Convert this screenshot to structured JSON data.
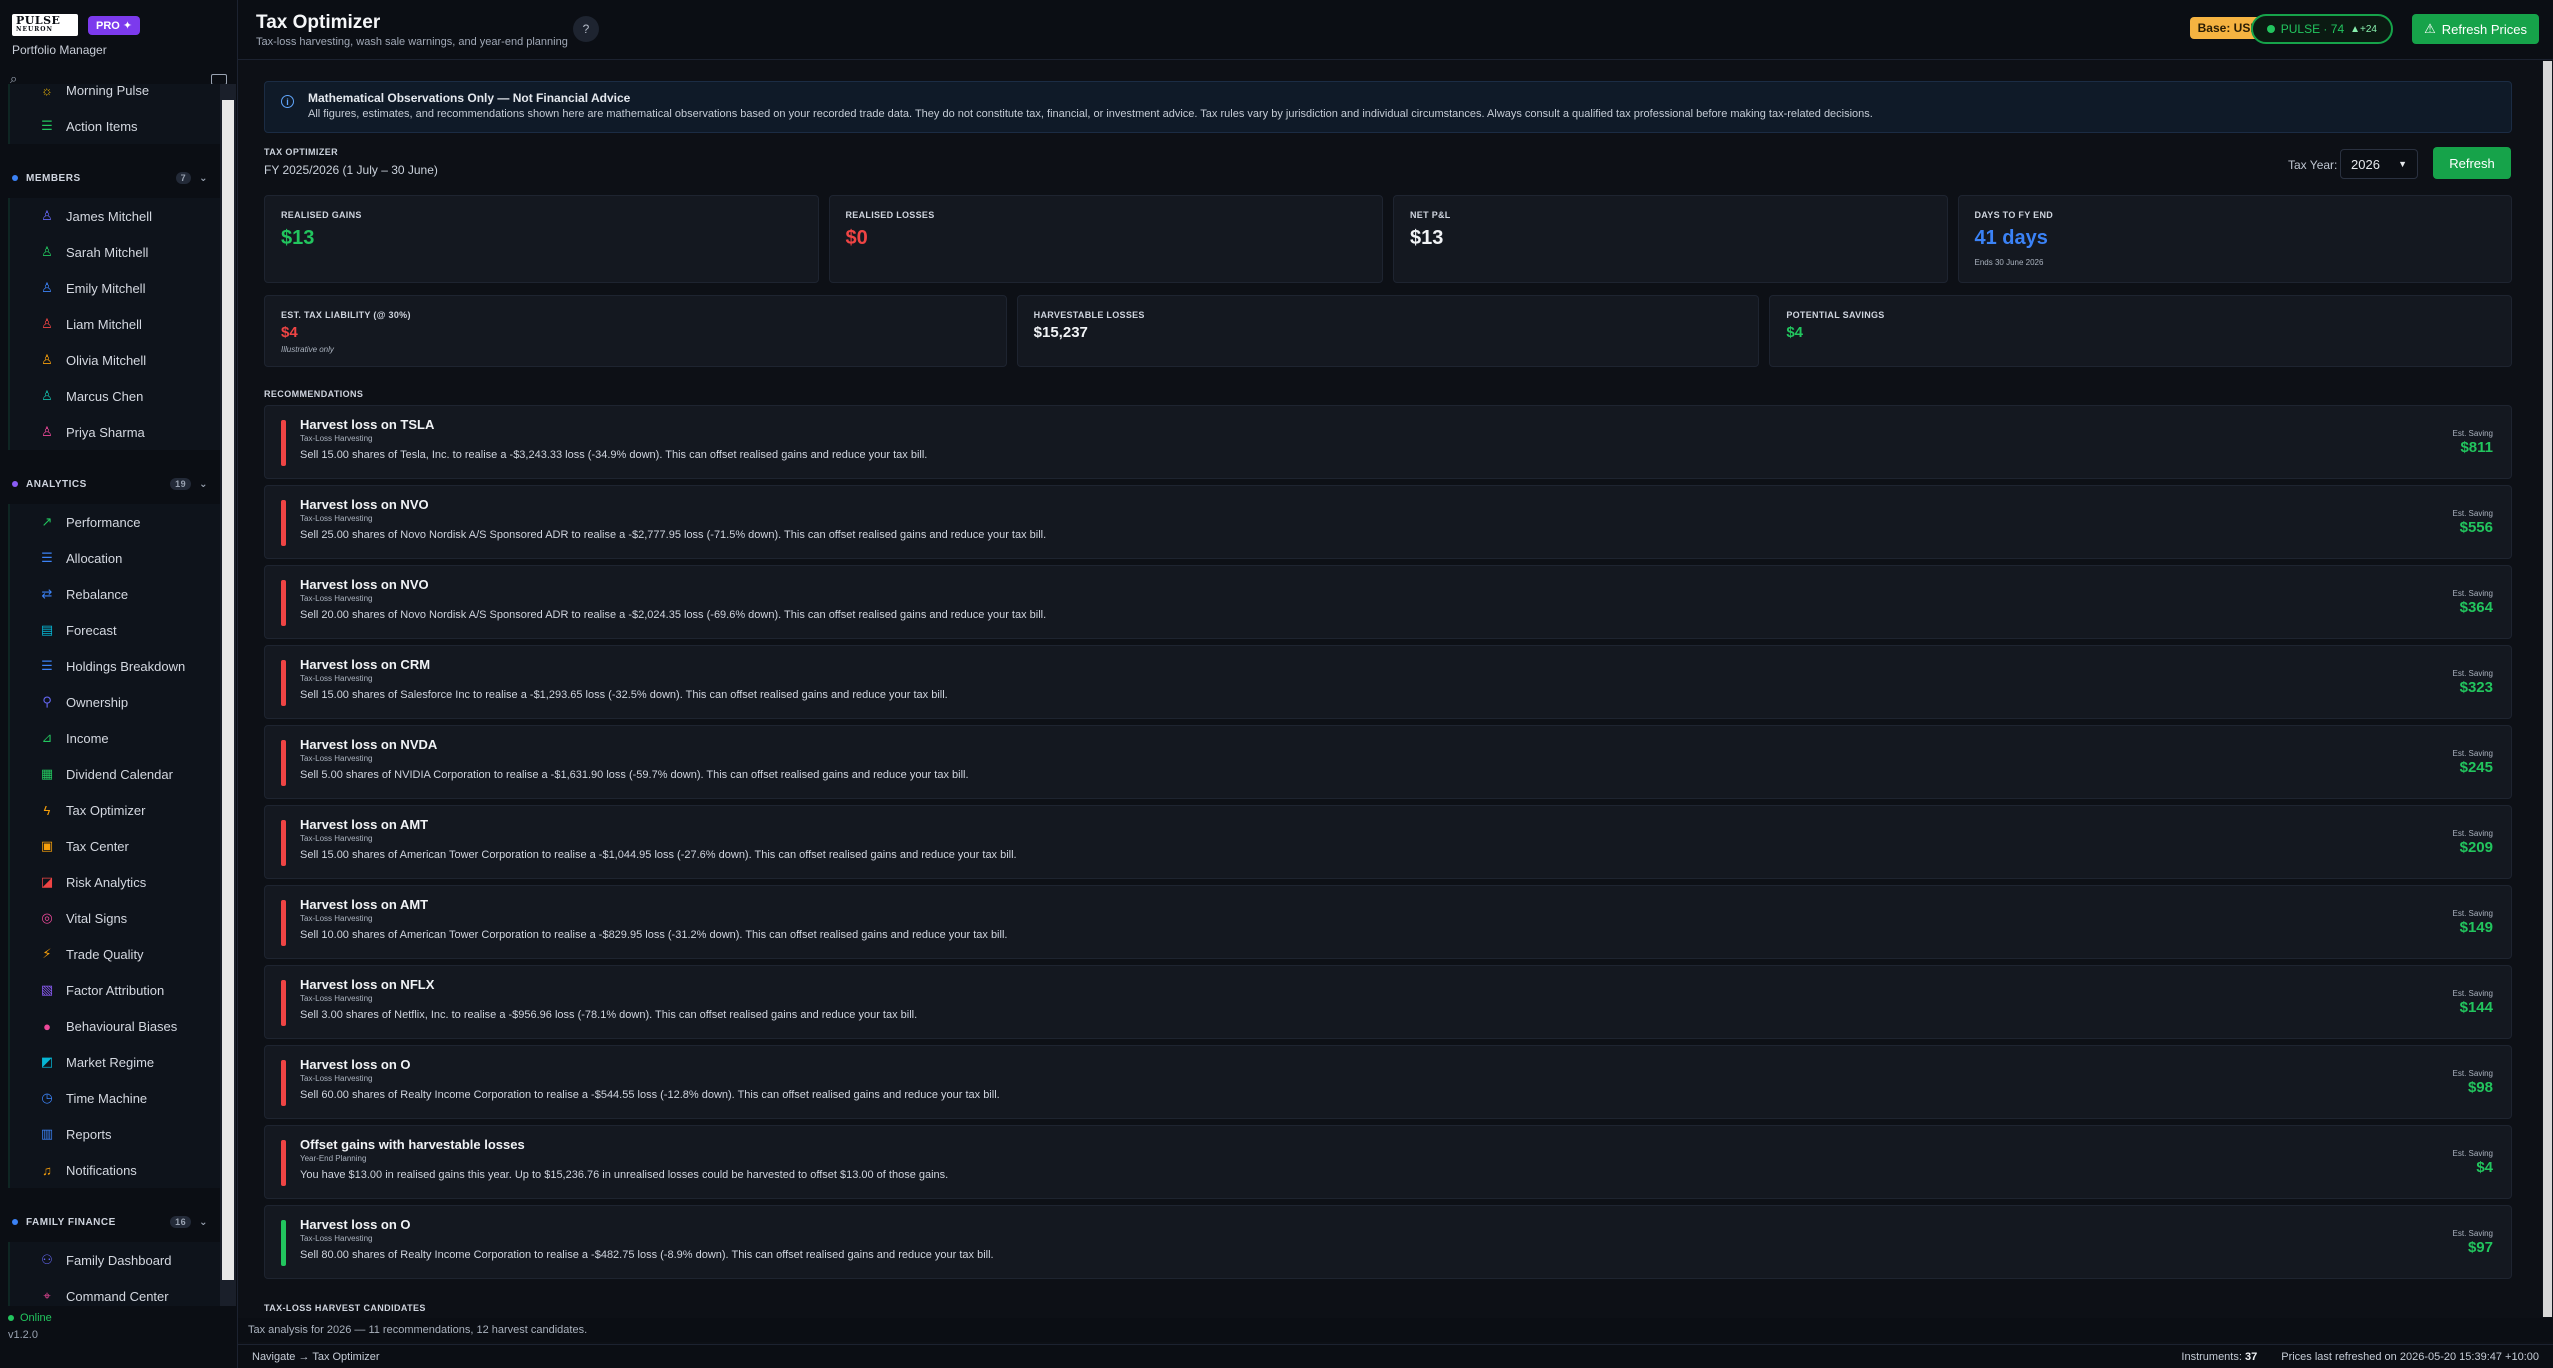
{
  "brand": {
    "logo_line1": "PULSE",
    "logo_line2": "NEURON",
    "pro_label": "PRO ✦",
    "subtitle": "Portfolio Manager"
  },
  "sidebar": {
    "top_items": [
      {
        "label": "Morning Pulse",
        "icon": "sun-icon",
        "color": "#eab308"
      },
      {
        "label": "Action Items",
        "icon": "checklist-icon",
        "color": "#22c55e"
      }
    ],
    "sections": [
      {
        "title": "MEMBERS",
        "count": "7",
        "dot_color": "#3b82f6",
        "items": [
          {
            "label": "James Mitchell",
            "color": "#6366f1"
          },
          {
            "label": "Sarah Mitchell",
            "color": "#22c55e"
          },
          {
            "label": "Emily Mitchell",
            "color": "#3b82f6"
          },
          {
            "label": "Liam Mitchell",
            "color": "#ef4444"
          },
          {
            "label": "Olivia Mitchell",
            "color": "#f59e0b"
          },
          {
            "label": "Marcus Chen",
            "color": "#14b8a6"
          },
          {
            "label": "Priya Sharma",
            "color": "#ec4899"
          }
        ]
      },
      {
        "title": "ANALYTICS",
        "count": "19",
        "dot_color": "#8b5cf6",
        "items": [
          {
            "label": "Performance",
            "icon": "chart-line-icon",
            "color": "#22c55e"
          },
          {
            "label": "Allocation",
            "icon": "list-icon",
            "color": "#3b82f6"
          },
          {
            "label": "Rebalance",
            "icon": "arrows-icon",
            "color": "#3b82f6"
          },
          {
            "label": "Forecast",
            "icon": "forecast-icon",
            "color": "#06b6d4"
          },
          {
            "label": "Holdings Breakdown",
            "icon": "list-icon",
            "color": "#3b82f6"
          },
          {
            "label": "Ownership",
            "icon": "ownership-icon",
            "color": "#6366f1"
          },
          {
            "label": "Income",
            "icon": "income-icon",
            "color": "#22c55e"
          },
          {
            "label": "Dividend Calendar",
            "icon": "calendar-icon",
            "color": "#22c55e"
          },
          {
            "label": "Tax Optimizer",
            "icon": "bolt-icon",
            "color": "#f59e0b"
          },
          {
            "label": "Tax Center",
            "icon": "tax-icon",
            "color": "#f59e0b"
          },
          {
            "label": "Risk Analytics",
            "icon": "risk-icon",
            "color": "#ef4444"
          },
          {
            "label": "Vital Signs",
            "icon": "vital-icon",
            "color": "#ec4899"
          },
          {
            "label": "Trade Quality",
            "icon": "trade-icon",
            "color": "#f59e0b"
          },
          {
            "label": "Factor Attribution",
            "icon": "factor-icon",
            "color": "#8b5cf6"
          },
          {
            "label": "Behavioural Biases",
            "icon": "circle-icon",
            "color": "#ec4899"
          },
          {
            "label": "Market Regime",
            "icon": "regime-icon",
            "color": "#06b6d4"
          },
          {
            "label": "Time Machine",
            "icon": "clock-icon",
            "color": "#3b82f6"
          },
          {
            "label": "Reports",
            "icon": "report-icon",
            "color": "#3b82f6"
          },
          {
            "label": "Notifications",
            "icon": "bell-icon",
            "color": "#f59e0b"
          }
        ]
      },
      {
        "title": "FAMILY FINANCE",
        "count": "16",
        "dot_color": "#3b82f6",
        "items": [
          {
            "label": "Family Dashboard",
            "icon": "family-icon",
            "color": "#6366f1"
          },
          {
            "label": "Command Center",
            "icon": "command-icon",
            "color": "#ec4899"
          }
        ]
      }
    ],
    "status": "Online",
    "version": "v1.2.0"
  },
  "header": {
    "title": "Tax Optimizer",
    "subtitle": "Tax-loss harvesting, wash sale warnings, and year-end planning",
    "help": "?",
    "base_currency": "Base: USD",
    "pulse_label": "PULSE · 74",
    "pulse_delta": "▲+24",
    "refresh_prices": "Refresh Prices"
  },
  "disclaimer": {
    "title": "Mathematical Observations Only — Not Financial Advice",
    "body": "All figures, estimates, and recommendations shown here are mathematical observations based on your recorded trade data. They do not constitute tax, financial, or investment advice. Tax rules vary by jurisdiction and individual circumstances. Always consult a qualified tax professional before making tax-related decisions."
  },
  "optimizer": {
    "label": "TAX OPTIMIZER",
    "fy": "FY 2025/2026  (1 July – 30 June)",
    "tax_year_label": "Tax Year:",
    "tax_year_value": "2026",
    "refresh": "Refresh"
  },
  "stats_row1": [
    {
      "label": "REALISED GAINS",
      "value": "$13",
      "color": "#22c55e",
      "note": ""
    },
    {
      "label": "REALISED LOSSES",
      "value": "$0",
      "color": "#ef4444",
      "note": ""
    },
    {
      "label": "NET P&L",
      "value": "$13",
      "color": "#f1f3f6",
      "note": ""
    },
    {
      "label": "DAYS TO FY END",
      "value": "41 days",
      "color": "#3b82f6",
      "note": "Ends 30 June 2026"
    }
  ],
  "stats_row2": [
    {
      "label": "EST. TAX LIABILITY (@ 30%)",
      "value": "$4",
      "color": "#ef4444",
      "note": "Illustrative only"
    },
    {
      "label": "HARVESTABLE LOSSES",
      "value": "$15,237",
      "color": "#f1f3f6",
      "note": ""
    },
    {
      "label": "POTENTIAL SAVINGS",
      "value": "$4",
      "color": "#22c55e",
      "note": ""
    }
  ],
  "recommendations_heading": "RECOMMENDATIONS",
  "saving_label": "Est. Saving",
  "recommendations": [
    {
      "title": "Harvest loss on TSLA",
      "tag": "Tax-Loss Harvesting",
      "desc": "Sell 15.00 shares of Tesla, Inc. to realise a -$3,243.33 loss (-34.9% down). This can offset realised gains and reduce your tax bill.",
      "saving": "$811",
      "accent": "#ef4444"
    },
    {
      "title": "Harvest loss on NVO",
      "tag": "Tax-Loss Harvesting",
      "desc": "Sell 25.00 shares of Novo Nordisk A/S Sponsored ADR to realise a -$2,777.95 loss (-71.5% down). This can offset realised gains and reduce your tax bill.",
      "saving": "$556",
      "accent": "#ef4444"
    },
    {
      "title": "Harvest loss on NVO",
      "tag": "Tax-Loss Harvesting",
      "desc": "Sell 20.00 shares of Novo Nordisk A/S Sponsored ADR to realise a -$2,024.35 loss (-69.6% down). This can offset realised gains and reduce your tax bill.",
      "saving": "$364",
      "accent": "#ef4444"
    },
    {
      "title": "Harvest loss on CRM",
      "tag": "Tax-Loss Harvesting",
      "desc": "Sell 15.00 shares of Salesforce Inc to realise a -$1,293.65 loss (-32.5% down). This can offset realised gains and reduce your tax bill.",
      "saving": "$323",
      "accent": "#ef4444"
    },
    {
      "title": "Harvest loss on NVDA",
      "tag": "Tax-Loss Harvesting",
      "desc": "Sell 5.00 shares of NVIDIA Corporation to realise a -$1,631.90 loss (-59.7% down). This can offset realised gains and reduce your tax bill.",
      "saving": "$245",
      "accent": "#ef4444"
    },
    {
      "title": "Harvest loss on AMT",
      "tag": "Tax-Loss Harvesting",
      "desc": "Sell 15.00 shares of American Tower Corporation to realise a -$1,044.95 loss (-27.6% down). This can offset realised gains and reduce your tax bill.",
      "saving": "$209",
      "accent": "#ef4444"
    },
    {
      "title": "Harvest loss on AMT",
      "tag": "Tax-Loss Harvesting",
      "desc": "Sell 10.00 shares of American Tower Corporation to realise a -$829.95 loss (-31.2% down). This can offset realised gains and reduce your tax bill.",
      "saving": "$149",
      "accent": "#ef4444"
    },
    {
      "title": "Harvest loss on NFLX",
      "tag": "Tax-Loss Harvesting",
      "desc": "Sell 3.00 shares of Netflix, Inc. to realise a -$956.96 loss (-78.1% down). This can offset realised gains and reduce your tax bill.",
      "saving": "$144",
      "accent": "#ef4444"
    },
    {
      "title": "Harvest loss on O",
      "tag": "Tax-Loss Harvesting",
      "desc": "Sell 60.00 shares of Realty Income Corporation to realise a -$544.55 loss (-12.8% down). This can offset realised gains and reduce your tax bill.",
      "saving": "$98",
      "accent": "#ef4444"
    },
    {
      "title": "Offset gains with harvestable losses",
      "tag": "Year-End Planning",
      "desc": "You have $13.00 in realised gains this year. Up to $15,236.76 in unrealised losses could be harvested to offset $13.00 of those gains.",
      "saving": "$4",
      "accent": "#ef4444"
    },
    {
      "title": "Harvest loss on O",
      "tag": "Tax-Loss Harvesting",
      "desc": "Sell 80.00 shares of Realty Income Corporation to realise a -$482.75 loss (-8.9% down). This can offset realised gains and reduce your tax bill.",
      "saving": "$97",
      "accent": "#22c55e"
    }
  ],
  "candidates_heading": "TAX-LOSS HARVEST CANDIDATES",
  "status_message": "Tax analysis for 2026 — 11 recommendations, 12 harvest candidates.",
  "footer": {
    "navigate": "Navigate → Tax Optimizer",
    "instruments_label": "Instruments:",
    "instruments_value": "37",
    "refreshed": "Prices last refreshed on 2026-05-20 15:39:47 +10:00"
  }
}
